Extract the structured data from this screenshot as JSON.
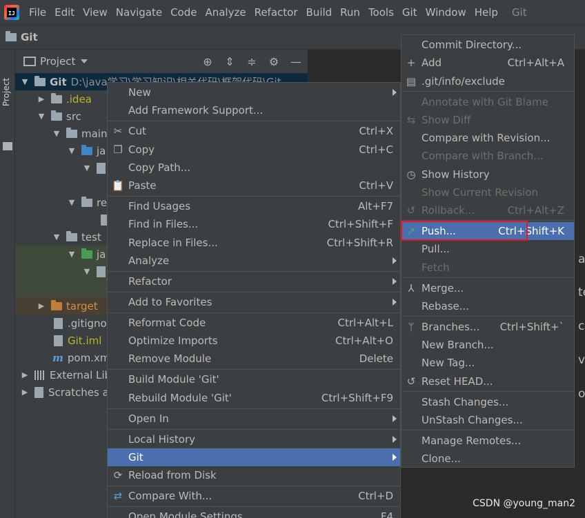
{
  "menubar": {
    "items": [
      {
        "label": "File"
      },
      {
        "label": "Edit"
      },
      {
        "label": "View"
      },
      {
        "label": "Navigate"
      },
      {
        "label": "Code"
      },
      {
        "label": "Analyze"
      },
      {
        "label": "Refactor"
      },
      {
        "label": "Build"
      },
      {
        "label": "Run"
      },
      {
        "label": "Tools"
      },
      {
        "label": "Git"
      },
      {
        "label": "Window"
      },
      {
        "label": "Help"
      }
    ],
    "window_title": "Git"
  },
  "navbar": {
    "label": "Git"
  },
  "toolstrip": {
    "project_tab": "Project"
  },
  "project_panel": {
    "title": "Project"
  },
  "tree": {
    "root_name": "Git",
    "root_path": "D:\\java学习\\学习知识\\相关代码\\框架代码\\Git",
    "idea": ".idea",
    "src": "src",
    "main": "main",
    "java1": "ja",
    "resources": "re",
    "test": "test",
    "java2": "ja",
    "target": "target",
    "gitignore": ".gitigno",
    "gitiml": "Git.iml",
    "pom": "pom.xm",
    "m_glyph": "m",
    "external": "External Lib",
    "scratches": "Scratches a"
  },
  "editor_fragments": [
    "ar",
    "te",
    "ce",
    "vi",
    "op"
  ],
  "context_menu": {
    "items": [
      {
        "label": "New",
        "shortcut": ""
      },
      {
        "label": "Add Framework Support...",
        "shortcut": ""
      },
      {
        "label": "Cut",
        "shortcut": "Ctrl+X"
      },
      {
        "label": "Copy",
        "shortcut": "Ctrl+C"
      },
      {
        "label": "Copy Path...",
        "shortcut": ""
      },
      {
        "label": "Paste",
        "shortcut": "Ctrl+V"
      },
      {
        "label": "Find Usages",
        "shortcut": "Alt+F7"
      },
      {
        "label": "Find in Files...",
        "shortcut": "Ctrl+Shift+F"
      },
      {
        "label": "Replace in Files...",
        "shortcut": "Ctrl+Shift+R"
      },
      {
        "label": "Analyze",
        "shortcut": ""
      },
      {
        "label": "Refactor",
        "shortcut": ""
      },
      {
        "label": "Add to Favorites",
        "shortcut": ""
      },
      {
        "label": "Reformat Code",
        "shortcut": "Ctrl+Alt+L"
      },
      {
        "label": "Optimize Imports",
        "shortcut": "Ctrl+Alt+O"
      },
      {
        "label": "Remove Module",
        "shortcut": "Delete"
      },
      {
        "label": "Build Module 'Git'",
        "shortcut": ""
      },
      {
        "label": "Rebuild Module 'Git'",
        "shortcut": "Ctrl+Shift+F9"
      },
      {
        "label": "Open In",
        "shortcut": ""
      },
      {
        "label": "Local History",
        "shortcut": ""
      },
      {
        "label": "Git",
        "shortcut": ""
      },
      {
        "label": "Reload from Disk",
        "shortcut": ""
      },
      {
        "label": "Compare With...",
        "shortcut": "Ctrl+D"
      },
      {
        "label": "Open Module Settings",
        "shortcut": "F4"
      }
    ]
  },
  "git_submenu": {
    "items": [
      {
        "label": "Commit Directory...",
        "shortcut": ""
      },
      {
        "label": "Add",
        "shortcut": "Ctrl+Alt+A"
      },
      {
        "label": ".git/info/exclude",
        "shortcut": ""
      },
      {
        "label": "Annotate with Git Blame",
        "shortcut": ""
      },
      {
        "label": "Show Diff",
        "shortcut": ""
      },
      {
        "label": "Compare with Revision...",
        "shortcut": ""
      },
      {
        "label": "Compare with Branch...",
        "shortcut": ""
      },
      {
        "label": "Show History",
        "shortcut": ""
      },
      {
        "label": "Show Current Revision",
        "shortcut": ""
      },
      {
        "label": "Rollback...",
        "shortcut": "Ctrl+Alt+Z"
      },
      {
        "label": "Push...",
        "shortcut": "Ctrl+Shift+K"
      },
      {
        "label": "Pull...",
        "shortcut": ""
      },
      {
        "label": "Fetch",
        "shortcut": ""
      },
      {
        "label": "Merge...",
        "shortcut": ""
      },
      {
        "label": "Rebase...",
        "shortcut": ""
      },
      {
        "label": "Branches...",
        "shortcut": "Ctrl+Shift+`"
      },
      {
        "label": "New Branch...",
        "shortcut": ""
      },
      {
        "label": "New Tag...",
        "shortcut": ""
      },
      {
        "label": "Reset HEAD...",
        "shortcut": ""
      },
      {
        "label": "Stash Changes...",
        "shortcut": ""
      },
      {
        "label": "UnStash Changes...",
        "shortcut": ""
      },
      {
        "label": "Manage Remotes...",
        "shortcut": ""
      },
      {
        "label": "Clone...",
        "shortcut": ""
      }
    ]
  },
  "watermark": "CSDN @young_man2",
  "colors": {
    "selection": "#4b6eaf",
    "highlight_box": "#e5191f",
    "push_icon": "#59a869"
  }
}
